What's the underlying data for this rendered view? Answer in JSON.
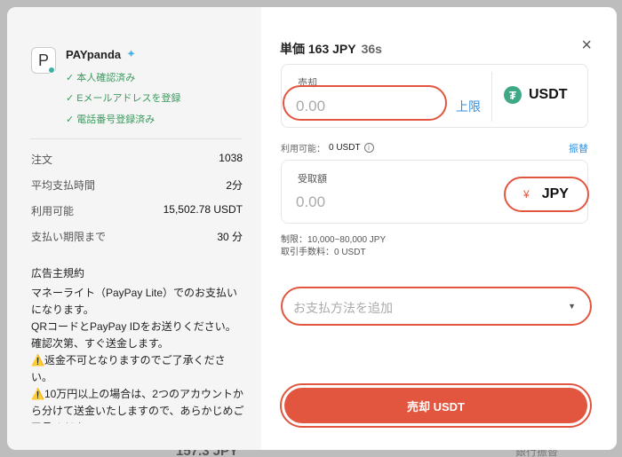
{
  "background": {
    "bottom_text": "157.3 JPY",
    "right_text": "銀行振替"
  },
  "advertiser": {
    "avatar_letter": "P",
    "name": "PAYpanda",
    "verifications": [
      "本人確認済み",
      "Eメールアドレスを登録",
      "電話番号登録済み"
    ]
  },
  "stats": [
    {
      "label": "注文",
      "value": "1038"
    },
    {
      "label": "平均支払時間",
      "value": "2分"
    },
    {
      "label": "利用可能",
      "value": "15,502.78 USDT"
    },
    {
      "label": "支払い期限まで",
      "value": "30 分"
    }
  ],
  "terms": {
    "title": "広告主規約",
    "body": "マネーライト（PayPay Lite）でのお支払いになります。\nQRコードとPayPay IDをお送りください。確認次第、すぐ送金します。\n⚠️返金不可となりますのでご了承ください。\n⚠️10万円以上の場合は、2つのアカウントから分けて送金いたしますので、あらかじめご了承ください。"
  },
  "order": {
    "price_label": "単価 163 JPY",
    "timer": "36s",
    "close_icon": "×"
  },
  "sell_box": {
    "label": "売却",
    "placeholder": "0.00",
    "max_label": "上限",
    "coin": "USDT",
    "coin_icon": "₮"
  },
  "available": {
    "label": "利用可能：",
    "value": "0 USDT",
    "info_icon": "i",
    "transfer_label": "振替"
  },
  "receive_box": {
    "label": "受取額",
    "placeholder": "0.00",
    "fiat_symbol": "¥",
    "fiat": "JPY"
  },
  "limits": {
    "limit_line": "制限：10,000~80,000 JPY",
    "fee_line": "取引手数料：0 USDT"
  },
  "payment": {
    "placeholder": "お支払方法を追加",
    "caret": "▼"
  },
  "submit": {
    "label": "売却 USDT"
  },
  "colors": {
    "accent": "#e2553f",
    "link": "#2f8fe0",
    "verified": "#3c9a5f",
    "usdt": "#3fa886"
  }
}
